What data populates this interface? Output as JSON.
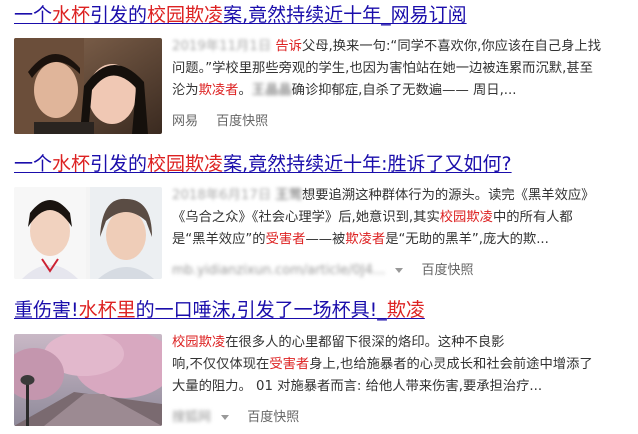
{
  "results": [
    {
      "title_parts": [
        {
          "text": "一个",
          "hl": false
        },
        {
          "text": "水杯",
          "hl": true
        },
        {
          "text": "引发的",
          "hl": false
        },
        {
          "text": "校园欺凌",
          "hl": true
        },
        {
          "text": "案,竟然持续近十年_网易订阅",
          "hl": false
        }
      ],
      "date": "2019年11月1日",
      "lines": [
        [
          {
            "text": "告诉",
            "hl": true
          },
          {
            "text": "父母,换来一句:“同学不喜欢你,你应该在自己身上找",
            "hl": false
          }
        ],
        [
          {
            "text": "问题。”学校里那些旁观的学生,也因为害怕站在她一边被连累而沉默,甚至",
            "hl": false
          }
        ],
        [
          {
            "text": "沦为",
            "hl": false
          },
          {
            "text": "欺凌者",
            "hl": true
          },
          {
            "text": "。",
            "hl": false
          },
          {
            "text": "王晶晶",
            "blur": true
          },
          {
            "text": "确诊抑郁症,自杀了无数遍—— 周日,...",
            "hl": false
          }
        ]
      ],
      "source": "网易",
      "snapshot": "百度快照"
    },
    {
      "title_parts": [
        {
          "text": "一个",
          "hl": false
        },
        {
          "text": "水杯",
          "hl": true
        },
        {
          "text": "引发的",
          "hl": false
        },
        {
          "text": "校园欺凌",
          "hl": true
        },
        {
          "text": "案,竟然持续近十年:胜诉了又如何?",
          "hl": false
        }
      ],
      "date": "2018年6月17日",
      "lines": [
        [
          {
            "text": "王莺",
            "blur": true
          },
          {
            "text": "想要追溯这种群体行为的源头。读完《黑羊效应》",
            "hl": false
          }
        ],
        [
          {
            "text": "《乌合之众》《社会心理学》后,她意识到,其实",
            "hl": false
          },
          {
            "text": "校园欺凌",
            "hl": true
          },
          {
            "text": "中的所有人都",
            "hl": false
          }
        ],
        [
          {
            "text": "是“黑羊效应”的",
            "hl": false
          },
          {
            "text": "受害者",
            "hl": true
          },
          {
            "text": "——被",
            "hl": false
          },
          {
            "text": "欺凌者",
            "hl": true
          },
          {
            "text": "是“无助的黑羊”,庞大的欺...",
            "hl": false
          }
        ]
      ],
      "source": "mb.yidianzixun.com/article/0J4...",
      "snapshot": "百度快照"
    },
    {
      "title_parts": [
        {
          "text": "重伤害!",
          "hl": false
        },
        {
          "text": "水杯里",
          "hl": true
        },
        {
          "text": "的一口唾沫,引发了一场杯具!_",
          "hl": false
        },
        {
          "text": "欺凌",
          "hl": true
        }
      ],
      "date": "",
      "lines": [
        [
          {
            "text": "校园欺凌",
            "hl": true
          },
          {
            "text": "在很多人的心里都留下很深的烙印。这种不良影",
            "hl": false
          }
        ],
        [
          {
            "text": "响,不仅仅体现在",
            "hl": false
          },
          {
            "text": "受害者",
            "hl": true
          },
          {
            "text": "身上,也给施暴者的心灵成长和社会前途中增添了",
            "hl": false
          }
        ],
        [
          {
            "text": "大量的阻力。 01 对施暴者而言: 给他人带来伤害,要承担治疗...",
            "hl": false
          }
        ]
      ],
      "source": "搜狐网",
      "snapshot": "百度快照"
    }
  ],
  "colors": {
    "link": "#1a0dab",
    "highlight": "#dd2222",
    "text": "#333333",
    "meta": "#666666"
  }
}
